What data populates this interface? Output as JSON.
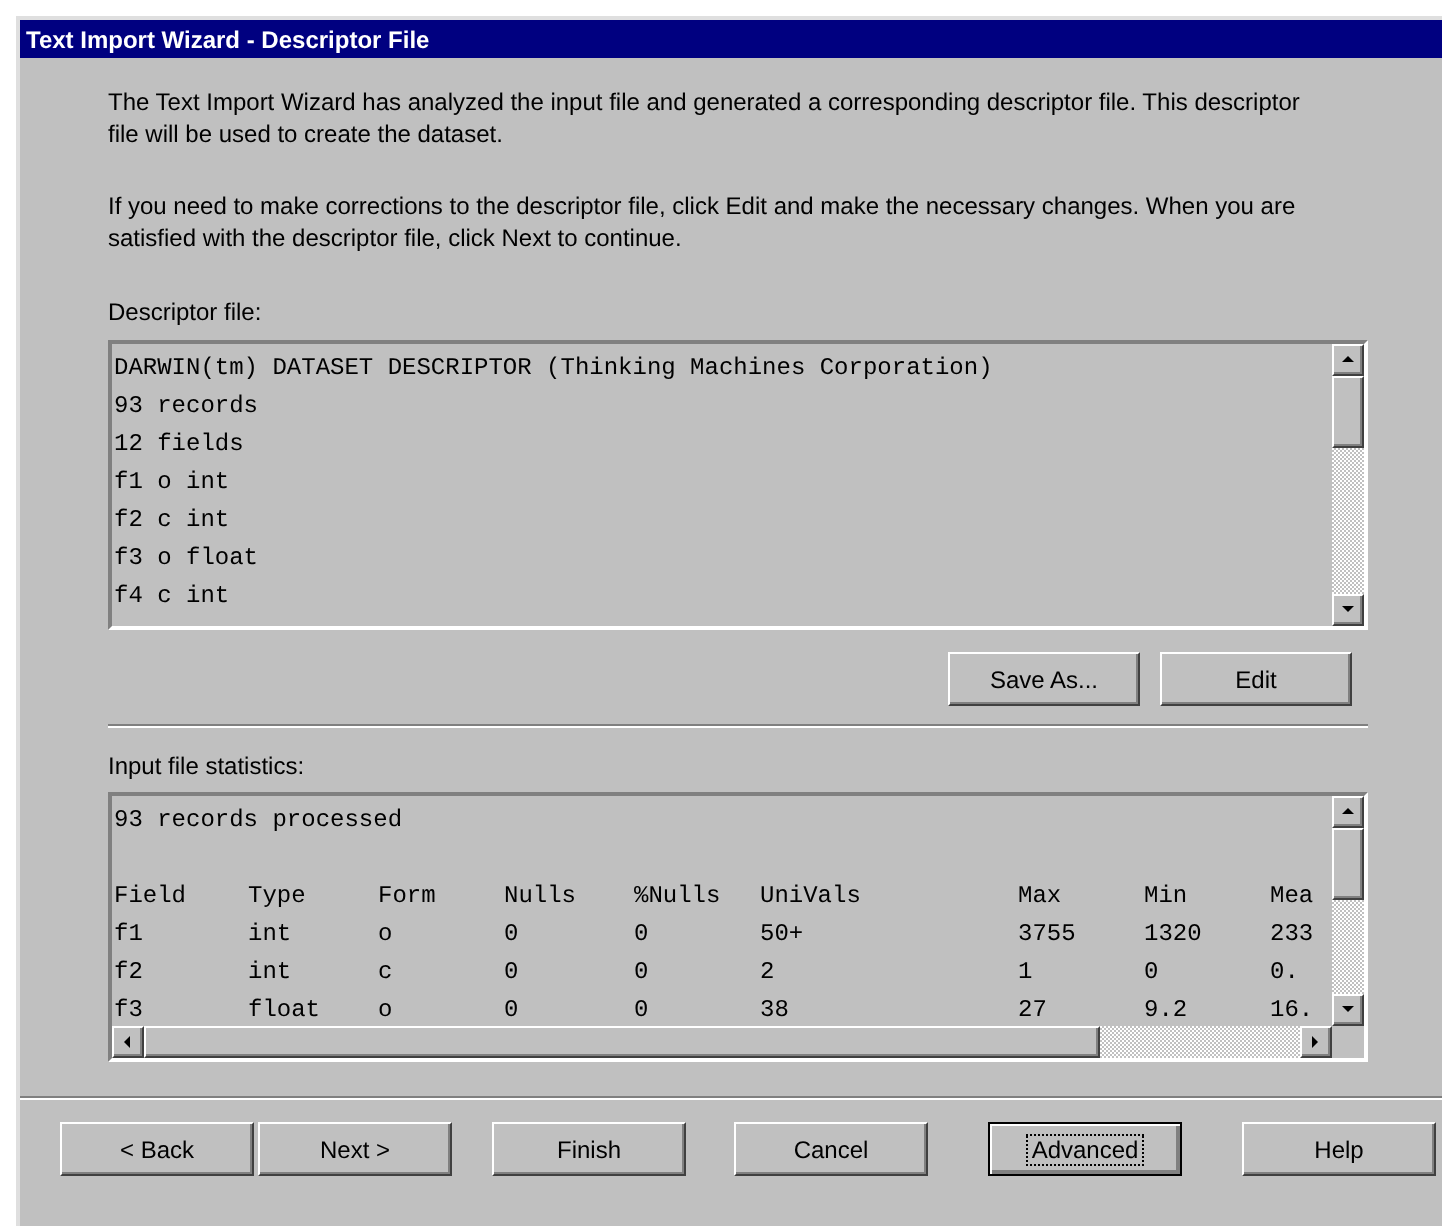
{
  "window": {
    "title": "Text Import Wizard - Descriptor File"
  },
  "intro": [
    "The Text Import Wizard has analyzed the input file and generated a corresponding descriptor file.  This descriptor file will be used to create the dataset.",
    "If you need to make corrections to the descriptor file, click Edit and make the necessary changes. When you are satisfied with the descriptor file, click Next to continue."
  ],
  "descriptor": {
    "label": "Descriptor file:",
    "lines": [
      "DARWIN(tm) DATASET DESCRIPTOR (Thinking Machines Corporation)",
      "93 records",
      "12 fields",
      "f1 o int",
      "f2 c int",
      "f3 o float",
      "f4 c int"
    ],
    "buttons": [
      "Save As...",
      "Edit"
    ]
  },
  "statistics": {
    "label": "Input file statistics:",
    "summary": "93 records processed",
    "columns": [
      "Field",
      "Type",
      "Form",
      "Nulls",
      "%Nulls",
      "UniVals",
      "Max",
      "Min",
      "Mea"
    ],
    "rows": [
      [
        "f1",
        "int",
        "o",
        "0",
        "0",
        "50+",
        "3755",
        "1320",
        "233"
      ],
      [
        "f2",
        "int",
        "c",
        "0",
        "0",
        "2",
        "1",
        "0",
        "0."
      ],
      [
        "f3",
        "float",
        "o",
        "0",
        "0",
        "38",
        "27",
        "9.2",
        "16."
      ]
    ]
  },
  "buttons": [
    {
      "label": "< Back",
      "default": false
    },
    {
      "label": "Next >",
      "default": false
    },
    {
      "label": "Finish",
      "default": false
    },
    {
      "label": "Cancel",
      "default": false
    },
    {
      "label": "Advanced",
      "default": true
    },
    {
      "label": "Help",
      "default": false
    }
  ]
}
